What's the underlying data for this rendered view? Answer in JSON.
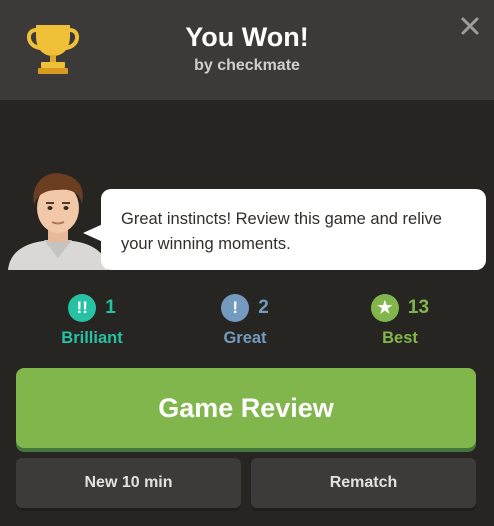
{
  "header": {
    "title": "You Won!",
    "subtitle": "by checkmate"
  },
  "coach": {
    "message": "Great instincts! Review this game and relive your winning moments."
  },
  "stats": [
    {
      "symbol": "!!",
      "count": "1",
      "label": "Brilliant",
      "color": "#26c2a3",
      "icon": "brilliant-icon"
    },
    {
      "symbol": "!",
      "count": "2",
      "label": "Great",
      "color": "#749bbf",
      "icon": "great-icon"
    },
    {
      "symbol": "★",
      "count": "13",
      "label": "Best",
      "color": "#81b64c",
      "icon": "star-icon"
    }
  ],
  "buttons": {
    "review": "Game Review",
    "new_game": "New 10 min",
    "rematch": "Rematch"
  },
  "colors": {
    "accent_green": "#81b64c",
    "brilliant": "#26c2a3",
    "great": "#749bbf",
    "trophy_gold": "#f0c039"
  }
}
